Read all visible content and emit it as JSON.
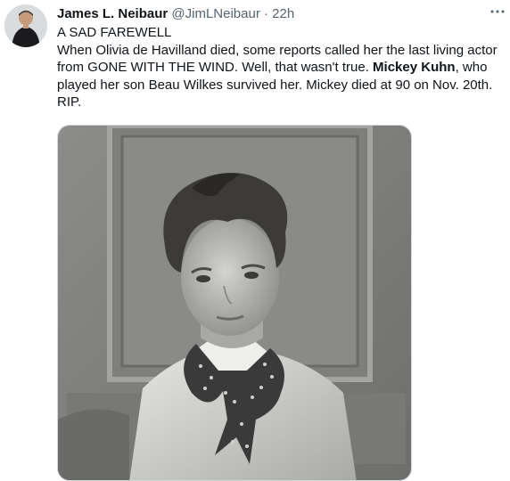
{
  "tweet": {
    "author_name": "James L. Neibaur",
    "author_handle": "@JimLNeibaur",
    "separator": "·",
    "time": "22h",
    "more_icon": "ellipsis-icon",
    "text_line1": "A SAD FAREWELL",
    "text_before_mention": "When Olivia de Havilland died, some reports called her the last living actor from GONE WITH THE WIND. Well, that wasn't true. ",
    "mention": "Mickey Kuhn",
    "text_after_mention": ", who played her son Beau Wilkes survived her. Mickey died at 90 on Nov. 20th. RIP.",
    "avatar_icon": "user-avatar",
    "media_icon": "photo"
  }
}
